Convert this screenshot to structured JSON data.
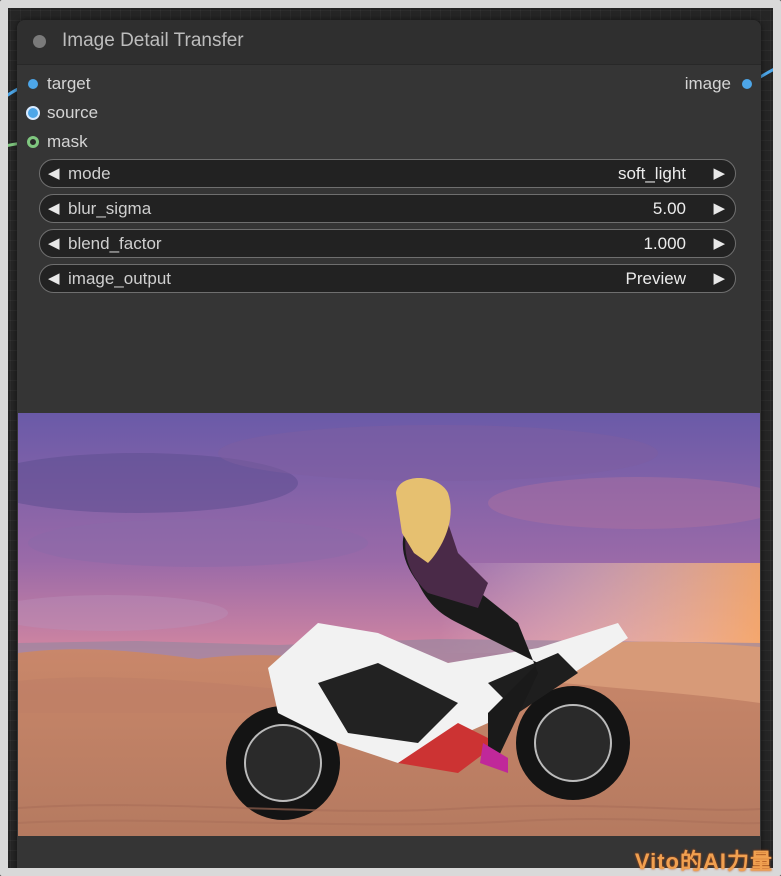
{
  "node": {
    "title": "Image Detail Transfer",
    "inputs": [
      {
        "label": "target",
        "color": "#4da6e8"
      },
      {
        "label": "source",
        "color": "#4da6e8"
      },
      {
        "label": "mask",
        "color": "#7fc77f"
      }
    ],
    "outputs": [
      {
        "label": "image",
        "color": "#4da6e8"
      }
    ],
    "widgets": [
      {
        "name": "mode",
        "value": "soft_light"
      },
      {
        "name": "blur_sigma",
        "value": "5.00"
      },
      {
        "name": "blend_factor",
        "value": "1.000"
      },
      {
        "name": "image_output",
        "value": "Preview"
      }
    ]
  },
  "watermark": "Vito的AI力量",
  "colors": {
    "node_bg": "#353535",
    "header_bg": "#2f2f2f",
    "widget_bg": "#222222",
    "image_link": "#4da6e8",
    "mask_link": "#7fc77f"
  }
}
